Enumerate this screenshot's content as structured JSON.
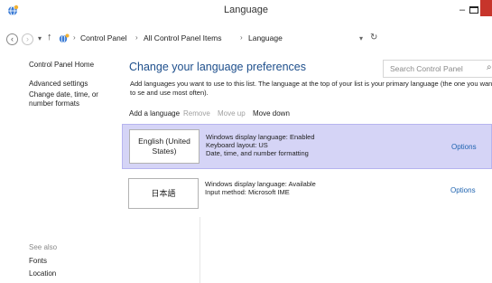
{
  "window": {
    "title": "Language",
    "minimize_label": "–"
  },
  "address": {
    "crumbs": [
      "Control Panel",
      "All Control Panel Items",
      "Language"
    ],
    "separator": "›",
    "search_placeholder": "Search Control Panel",
    "back_label": "‹",
    "forward_label": "›",
    "up_label": "↑",
    "dropdown_label": "▾",
    "refresh_label": "↻",
    "search_label": "⌕"
  },
  "sidebar": {
    "items": [
      "Control Panel Home",
      "Advanced settings",
      "Change date, time, or number formats"
    ],
    "see_also_title": "See also",
    "see_also_items": [
      "Fonts",
      "Location"
    ]
  },
  "main": {
    "heading": "Change your language preferences",
    "description": "Add languages you want to use to this list. The language at the top of your list is your primary language (the one you want to se and use most often).",
    "toolbar": {
      "add": "Add a language",
      "remove": "Remove",
      "move_up": "Move up",
      "move_down": "Move down"
    },
    "languages": [
      {
        "name": "English (United States)",
        "details": [
          "Windows display language: Enabled",
          "Keyboard layout: US",
          "Date, time, and number formatting"
        ],
        "options": "Options"
      },
      {
        "name": "日本語",
        "details": [
          "Windows display language: Available",
          "Input method: Microsoft IME"
        ],
        "options": "Options"
      }
    ]
  },
  "colors": {
    "heading": "#1e4f8c",
    "selected_row": "#d5d4f6",
    "link": "#1e63b0",
    "close_button": "#c7352b"
  }
}
